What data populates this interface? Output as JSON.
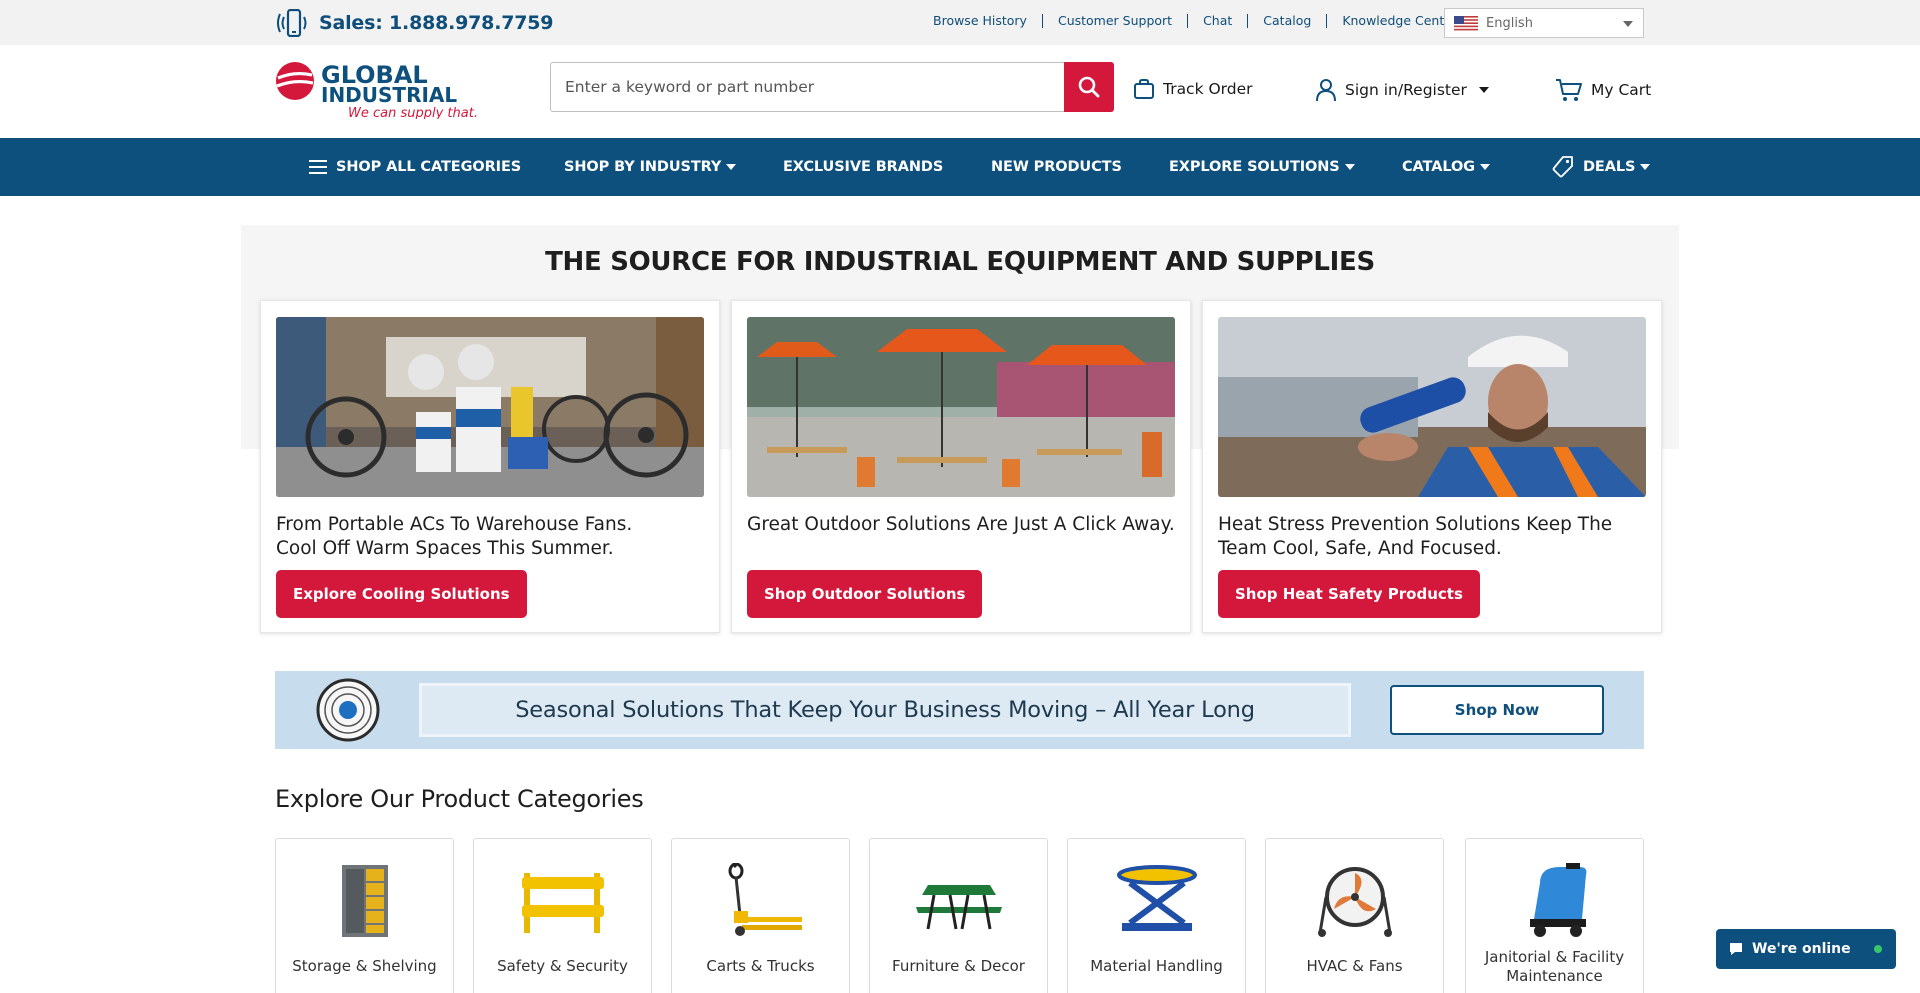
{
  "topbar": {
    "sales_text": "Sales: 1.888.978.7759",
    "links": [
      "Browse History",
      "Customer Support",
      "Chat",
      "Catalog",
      "Knowledge Center"
    ],
    "language": "English"
  },
  "header": {
    "logo": {
      "line1": "GLOBAL",
      "line2": "INDUSTRIAL",
      "tagline": "We can supply that."
    },
    "search_placeholder": "Enter a keyword or part number",
    "track_order": "Track Order",
    "sign_in": "Sign in/Register",
    "cart": "My Cart"
  },
  "nav": {
    "items": [
      {
        "label": "SHOP ALL CATEGORIES"
      },
      {
        "label": "SHOP BY INDUSTRY"
      },
      {
        "label": "EXCLUSIVE BRANDS"
      },
      {
        "label": "NEW PRODUCTS"
      },
      {
        "label": "EXPLORE SOLUTIONS"
      },
      {
        "label": "CATALOG"
      },
      {
        "label": "DEALS"
      }
    ]
  },
  "hero": {
    "title": "THE SOURCE FOR INDUSTRIAL EQUIPMENT AND SUPPLIES",
    "cards": [
      {
        "line1": "From Portable ACs To Warehouse Fans.",
        "line2": "Cool Off Warm Spaces This Summer.",
        "button": "Explore Cooling Solutions"
      },
      {
        "line1": "Great Outdoor Solutions Are Just A Click Away.",
        "line2": "",
        "button": "Shop Outdoor Solutions"
      },
      {
        "line1": "Heat Stress Prevention Solutions Keep The",
        "line2": "Team Cool, Safe, And Focused.",
        "button": "Shop Heat Safety Products"
      }
    ]
  },
  "banner": {
    "text": "Seasonal Solutions That Keep Your Business Moving – All Year Long",
    "button": "Shop Now"
  },
  "categories": {
    "heading": "Explore Our Product Categories",
    "items": [
      {
        "label": "Storage & Shelving"
      },
      {
        "label": "Safety & Security"
      },
      {
        "label": "Carts & Trucks"
      },
      {
        "label": "Furniture & Decor"
      },
      {
        "label": "Material Handling"
      },
      {
        "label": "HVAC & Fans"
      },
      {
        "label": "Janitorial & Facility Maintenance"
      }
    ]
  },
  "chat": {
    "label": "We're online"
  },
  "colors": {
    "brand_blue": "#0d4f7d",
    "brand_red": "#d3183c",
    "banner_bg": "#c7dced"
  }
}
